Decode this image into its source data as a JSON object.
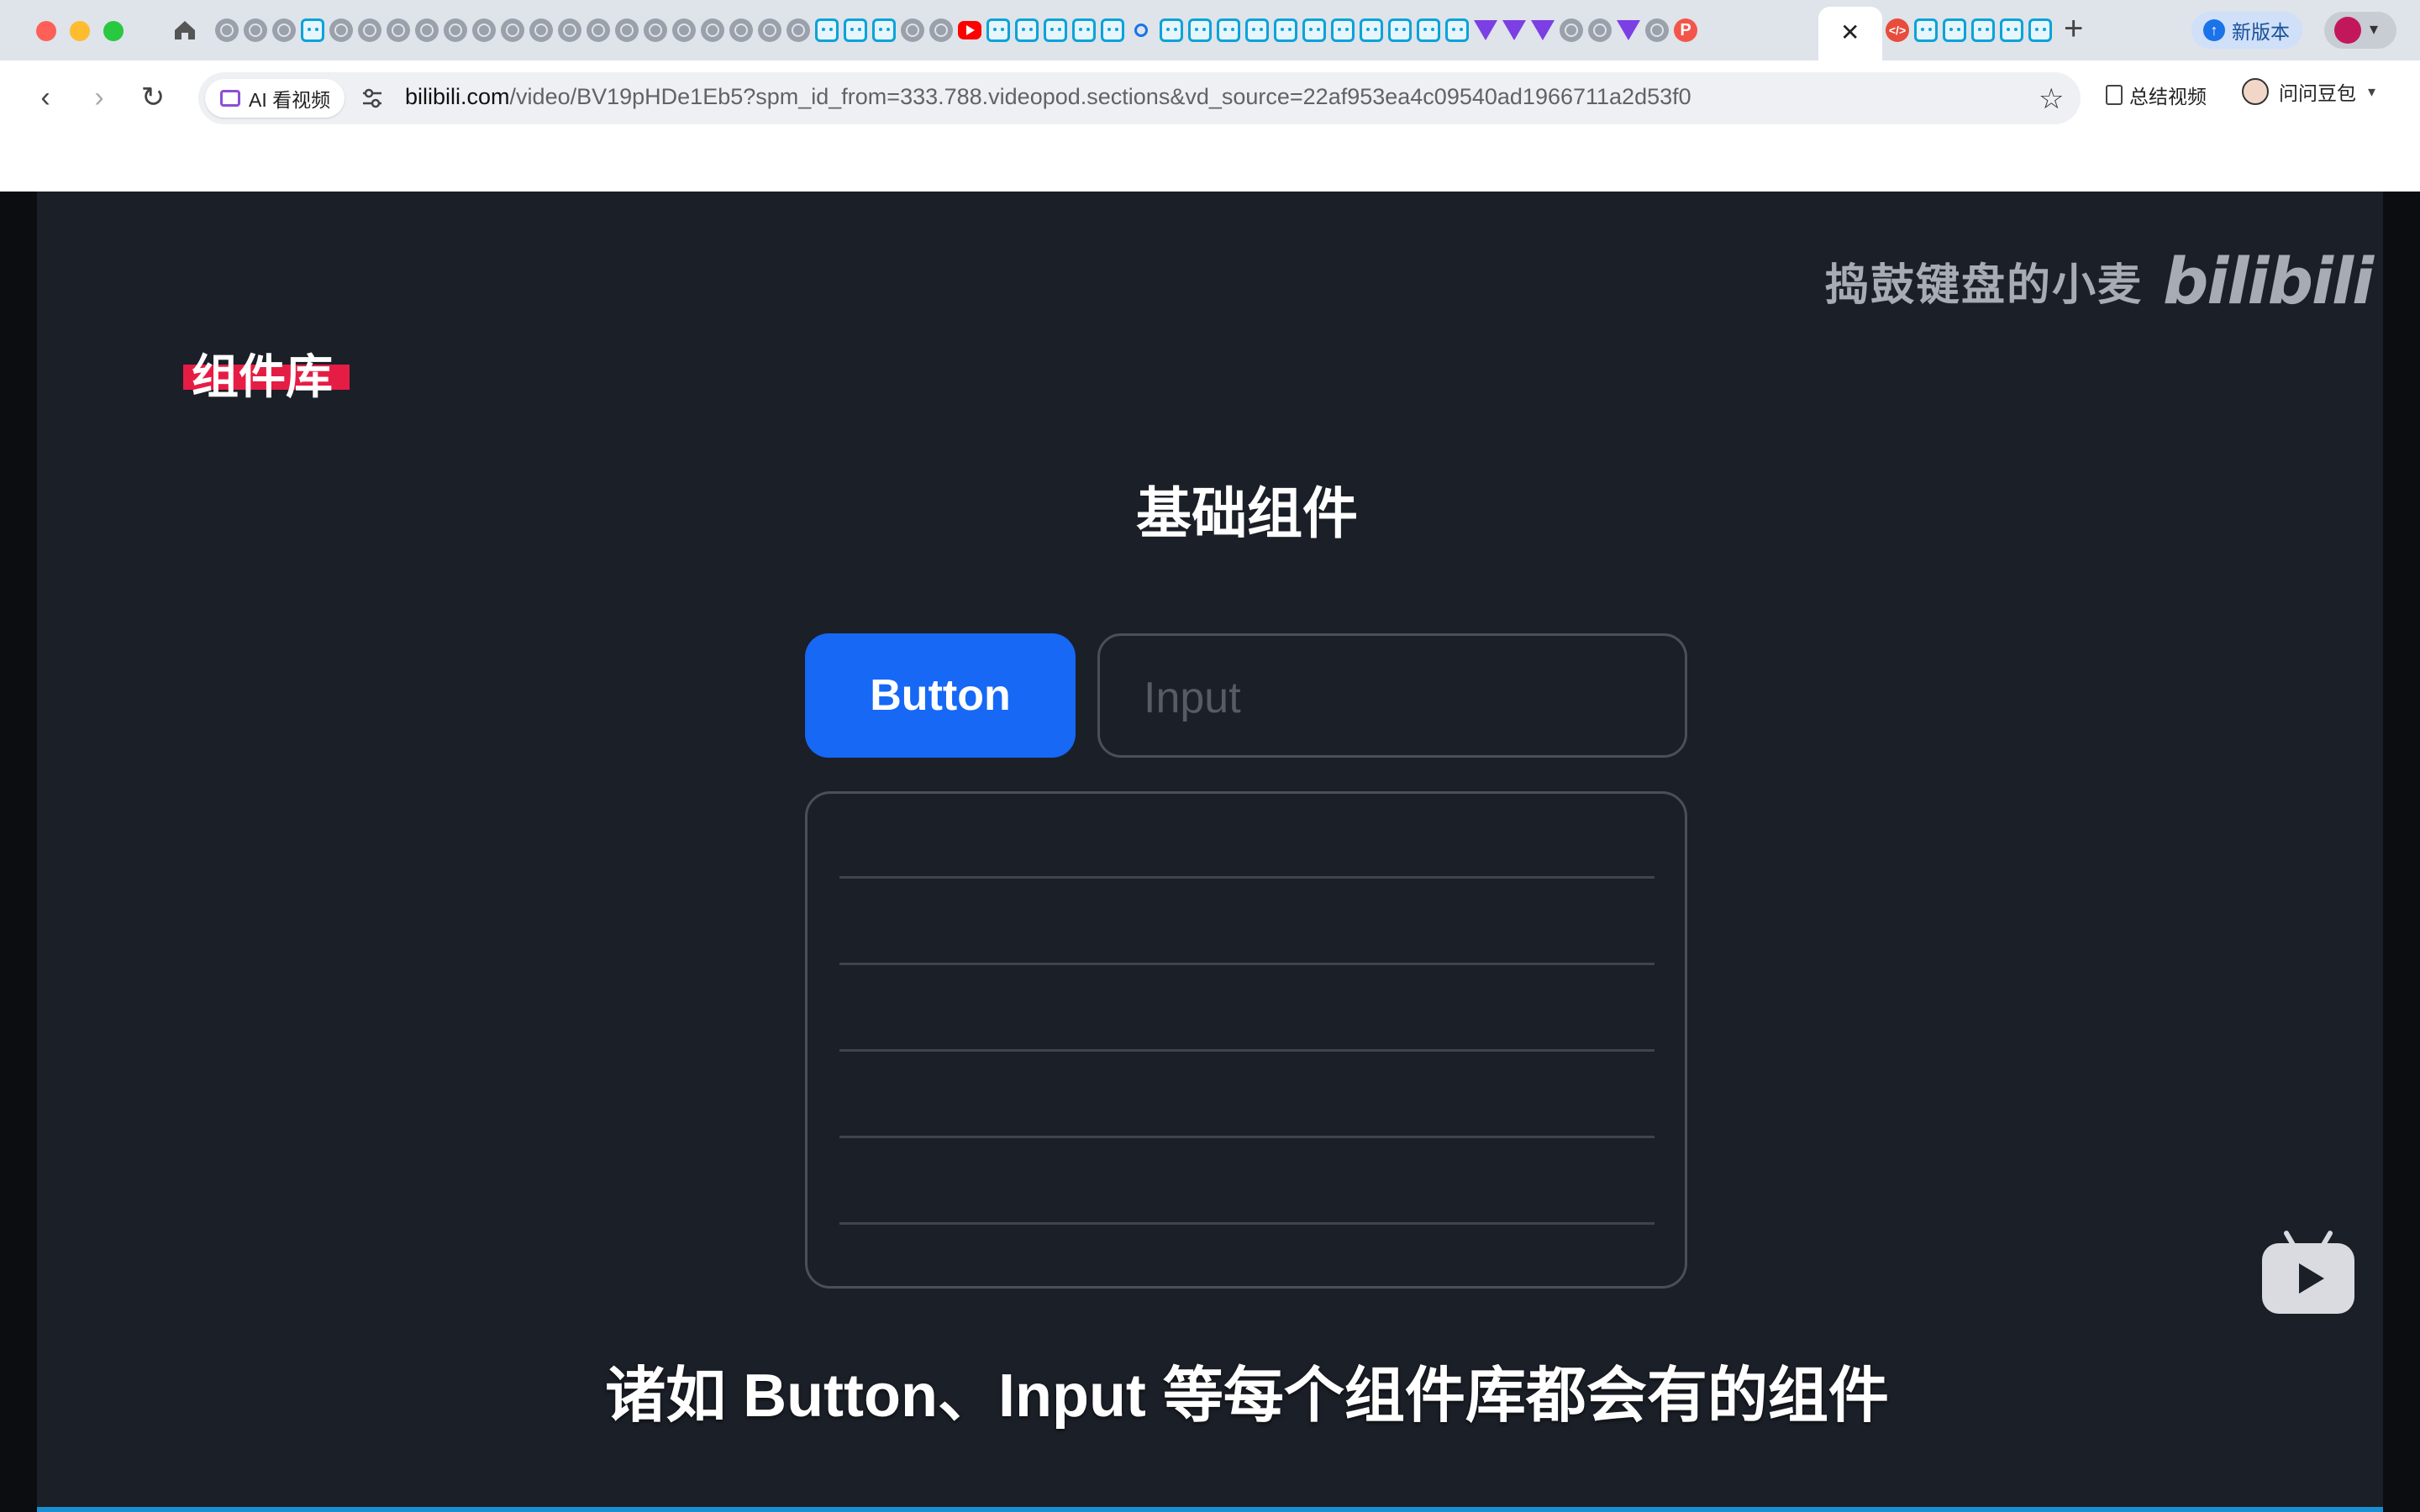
{
  "browser": {
    "tabs": {
      "favicons": [
        "home-icon",
        "globe-icon",
        "globe-icon",
        "globe-icon",
        "bilibili-icon",
        "globe-icon",
        "globe-icon",
        "globe-icon",
        "globe-icon",
        "globe-icon",
        "globe-icon",
        "globe-icon",
        "globe-icon",
        "globe-icon",
        "globe-icon",
        "globe-icon",
        "globe-icon",
        "globe-icon",
        "globe-icon",
        "globe-icon",
        "globe-icon",
        "globe-icon",
        "bilibili-icon",
        "bilibili-icon",
        "bilibili-icon",
        "globe-icon",
        "globe-icon",
        "youtube-icon",
        "bilibili-icon",
        "bilibili-icon",
        "bilibili-icon",
        "bilibili-icon",
        "bilibili-icon",
        "search-icon",
        "bilibili-icon",
        "bilibili-icon",
        "bilibili-icon",
        "bilibili-icon",
        "bilibili-icon",
        "bilibili-icon",
        "bilibili-icon",
        "bilibili-icon",
        "bilibili-icon",
        "bilibili-icon",
        "bilibili-icon",
        "vue-icon",
        "vue-icon",
        "vue-icon",
        "globe-icon",
        "globe-icon",
        "vue-icon",
        "globe-icon",
        "p-icon"
      ],
      "active_tab_close": "✕",
      "after_active_favicons": [
        "code-icon",
        "bilibili-icon",
        "bilibili-icon",
        "bilibili-icon",
        "bilibili-icon",
        "bilibili-icon"
      ],
      "new_tab": "+"
    },
    "new_version_label": "新版本",
    "toolbar": {
      "back": "‹",
      "forward": "›",
      "reload": "↻",
      "ai_chip_label": "AI 看视频",
      "url_host": "bilibili.com",
      "url_rest": "/video/BV19pHDe1Eb5?spm_id_from=333.788.videopod.sections&vd_source=22af953ea4c09540ad1966711a2d53f0",
      "bookmark_star": "☆",
      "summary_label": "总结视频",
      "doubao_label": "问问豆包",
      "doubao_caret": "▾"
    }
  },
  "video": {
    "watermark_name": "捣鼓键盘的小麦",
    "watermark_logo": "bilibili",
    "section_tag": "组件库",
    "heading": "基础组件",
    "demo_button_label": "Button",
    "demo_input_placeholder": "Input",
    "demo_list_rows": 5,
    "subtitle": "诸如 Button、Input 等每个组件库都会有的组件",
    "colors": {
      "background": "#1b1f27",
      "accent_button": "#1668f5",
      "tag_highlight": "#e51d45",
      "progress": "#1a8fd0"
    }
  }
}
